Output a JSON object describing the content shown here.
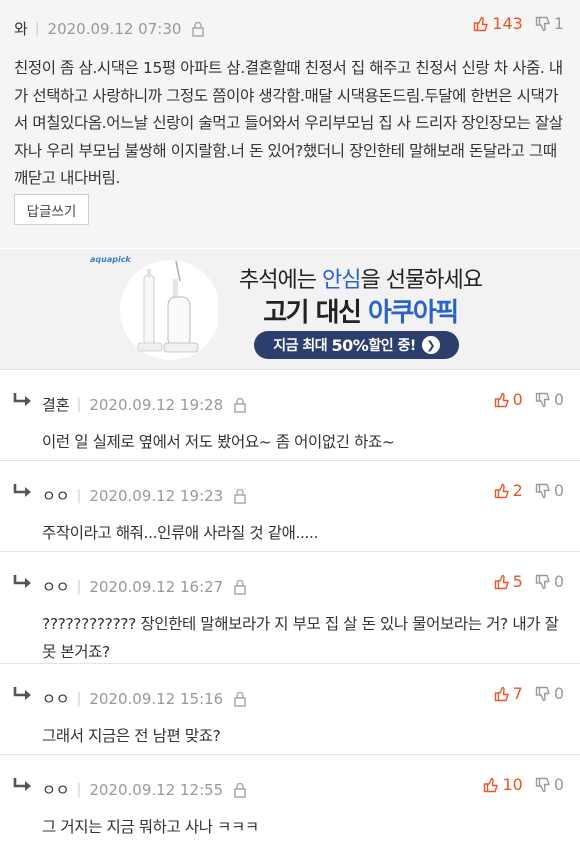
{
  "main_comment": {
    "nickname": "와",
    "date": "2020.09.12 07:30",
    "upvotes": "143",
    "downvotes": "1",
    "text": "친정이 좀 삼.시댁은 15평 아파트 삼.결혼할때 친정서 집 해주고 친정서 신랑 차 사줌. 내가 선택하고 사랑하니까 그정도 쯤이야 생각함.매달 시댁용돈드림.두달에 한번은 시댁가서 며칠있다옴.어느날 신랑이 술먹고 들어와서 우리부모님 집 사 드리자 장인장모는 잘살자나 우리 부모님 불쌍해 이지랄함.너 돈 있어?했더니 장인한테 말해보래 돈달라고 그때 깨닫고 내다버림.",
    "reply_button": "답글쓰기"
  },
  "ad": {
    "brand": "aquapick",
    "line1_pre": "추석에는 ",
    "line1_hl": "안심",
    "line1_post": "을 선물하세요",
    "line2_pre": "고기 대신 ",
    "line2_hl": "아쿠아픽",
    "pill_pre": "지금 최대 ",
    "pill_bold": "50%",
    "pill_post": " 할인 중!",
    "accent_color": "#2a63c8",
    "pill_color": "#2c3e6b"
  },
  "replies": [
    {
      "nickname": "결혼",
      "date": "2020.09.12 19:28",
      "upvotes": "0",
      "downvotes": "0",
      "text": "이런 일 실제로 옆에서 저도 봤어요~ 좀 어이없긴 하죠~"
    },
    {
      "nickname": "ㅇㅇ",
      "date": "2020.09.12 19:23",
      "upvotes": "2",
      "downvotes": "0",
      "text": "주작이라고 해줘...인류애 사라질 것 같애....."
    },
    {
      "nickname": "ㅇㅇ",
      "date": "2020.09.12 16:27",
      "upvotes": "5",
      "downvotes": "0",
      "text": "???????????? 장인한테 말해보라가 지 부모 집 살 돈 있나 물어보라는 거? 내가 잘못 본거죠?"
    },
    {
      "nickname": "ㅇㅇ",
      "date": "2020.09.12 15:16",
      "upvotes": "7",
      "downvotes": "0",
      "text": "그래서 지금은 전 남편 맞죠?"
    },
    {
      "nickname": "ㅇㅇ",
      "date": "2020.09.12 12:55",
      "upvotes": "10",
      "downvotes": "0",
      "text": "그 거지는 지금 뭐하고 사나 ㅋㅋㅋ"
    }
  ],
  "icons": {
    "upvote": "thumbs-up-icon",
    "downvote": "thumbs-down-icon",
    "lock": "lock-icon",
    "reply_arrow": "reply-arrow-icon"
  },
  "colors": {
    "upvote": "#e8552a",
    "muted": "#999999"
  }
}
